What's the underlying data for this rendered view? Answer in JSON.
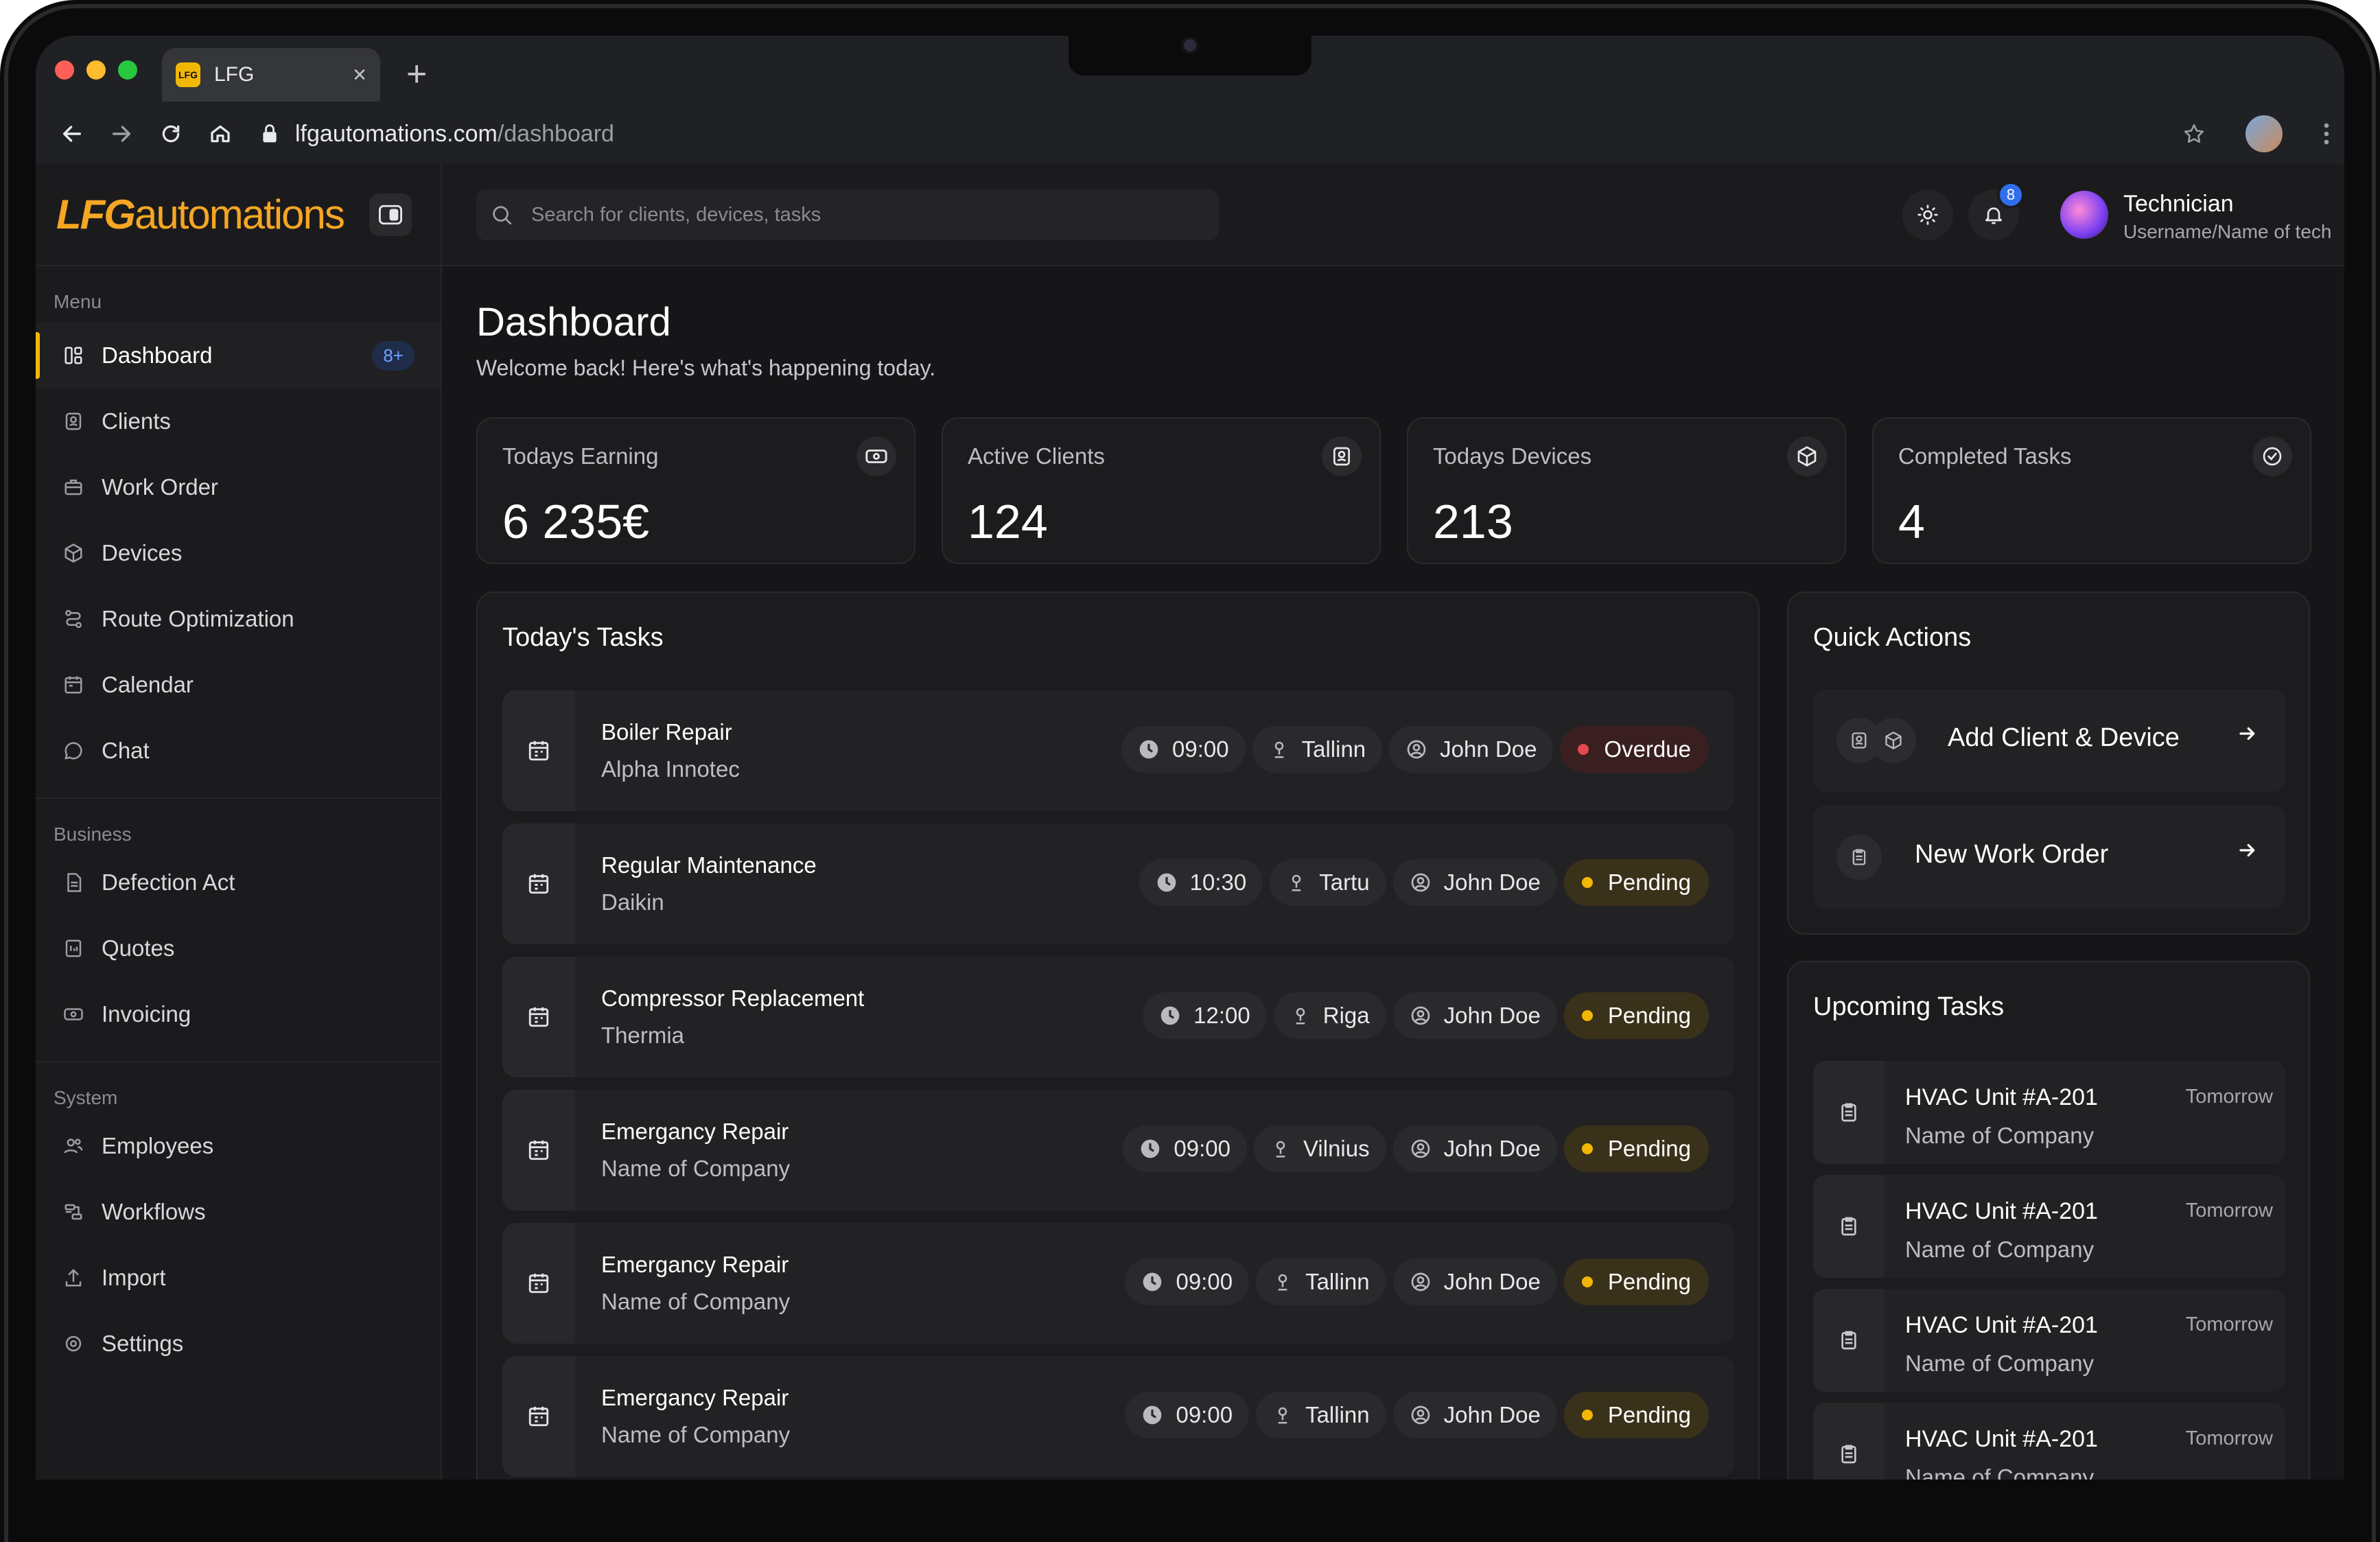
{
  "browser": {
    "tab_title": "LFG",
    "tab_favicon_text": "LFG",
    "url_host": "lfgautomations.com",
    "url_path": "/dashboard"
  },
  "colors": {
    "accent": "#f2b705",
    "overdue": "#e5484d",
    "pending": "#f2b705",
    "info_badge": "#2f6fed"
  },
  "sidebar": {
    "logo_bold": "LFG",
    "logo_text": "automations",
    "menu_label": "Menu",
    "menu": [
      {
        "label": "Dashboard",
        "icon": "dashboard-icon",
        "badge": "8+"
      },
      {
        "label": "Clients",
        "icon": "client-card-icon"
      },
      {
        "label": "Work Order",
        "icon": "briefcase-icon"
      },
      {
        "label": "Devices",
        "icon": "cube-icon"
      },
      {
        "label": "Route Optimization",
        "icon": "route-icon"
      },
      {
        "label": "Calendar",
        "icon": "calendar-icon"
      },
      {
        "label": "Chat",
        "icon": "chat-icon"
      }
    ],
    "business_label": "Business",
    "business": [
      {
        "label": "Defection Act",
        "icon": "document-icon"
      },
      {
        "label": "Quotes",
        "icon": "quote-icon"
      },
      {
        "label": "Invoicing",
        "icon": "invoice-icon"
      }
    ],
    "system_label": "System",
    "system": [
      {
        "label": "Employees",
        "icon": "users-icon"
      },
      {
        "label": "Workflows",
        "icon": "workflow-icon"
      },
      {
        "label": "Import",
        "icon": "import-icon"
      },
      {
        "label": "Settings",
        "icon": "settings-icon"
      }
    ]
  },
  "topbar": {
    "search_placeholder": "Search for clients, devices, tasks",
    "notification_count": "8",
    "user_name": "Technician",
    "user_sub": "Username/Name of tech"
  },
  "page": {
    "title": "Dashboard",
    "subtitle": "Welcome back! Here's what's happening today."
  },
  "stats": [
    {
      "label": "Todays Earning",
      "value": "6 235€",
      "icon": "money-icon"
    },
    {
      "label": "Active Clients",
      "value": "124",
      "icon": "client-card-icon"
    },
    {
      "label": "Todays Devices",
      "value": "213",
      "icon": "cube-icon"
    },
    {
      "label": "Completed Tasks",
      "value": "4",
      "icon": "check-circle-icon"
    }
  ],
  "todays_tasks": {
    "title": "Today's Tasks",
    "items": [
      {
        "title": "Boiler Repair",
        "company": "Alpha Innotec",
        "time": "09:00",
        "city": "Tallinn",
        "tech": "John Doe",
        "status": "Overdue"
      },
      {
        "title": "Regular Maintenance",
        "company": "Daikin",
        "time": "10:30",
        "city": "Tartu",
        "tech": "John Doe",
        "status": "Pending"
      },
      {
        "title": "Compressor Replacement",
        "company": "Thermia",
        "time": "12:00",
        "city": "Riga",
        "tech": "John Doe",
        "status": "Pending"
      },
      {
        "title": "Emergancy Repair",
        "company": "Name of Company",
        "time": "09:00",
        "city": "Vilnius",
        "tech": "John Doe",
        "status": "Pending"
      },
      {
        "title": "Emergancy Repair",
        "company": "Name of Company",
        "time": "09:00",
        "city": "Tallinn",
        "tech": "John Doe",
        "status": "Pending"
      },
      {
        "title": "Emergancy Repair",
        "company": "Name of Company",
        "time": "09:00",
        "city": "Tallinn",
        "tech": "John Doe",
        "status": "Pending"
      }
    ]
  },
  "quick_actions": {
    "title": "Quick Actions",
    "items": [
      {
        "label": "Add Client & Device"
      },
      {
        "label": "New Work Order"
      }
    ]
  },
  "upcoming": {
    "title": "Upcoming Tasks",
    "items": [
      {
        "title": "HVAC Unit #A-201",
        "company": "Name of Company",
        "when": "Tomorrow"
      },
      {
        "title": "HVAC Unit #A-201",
        "company": "Name of Company",
        "when": "Tomorrow"
      },
      {
        "title": "HVAC Unit #A-201",
        "company": "Name of Company",
        "when": "Tomorrow"
      },
      {
        "title": "HVAC Unit #A-201",
        "company": "Name of Company",
        "when": "Tomorrow"
      }
    ]
  }
}
